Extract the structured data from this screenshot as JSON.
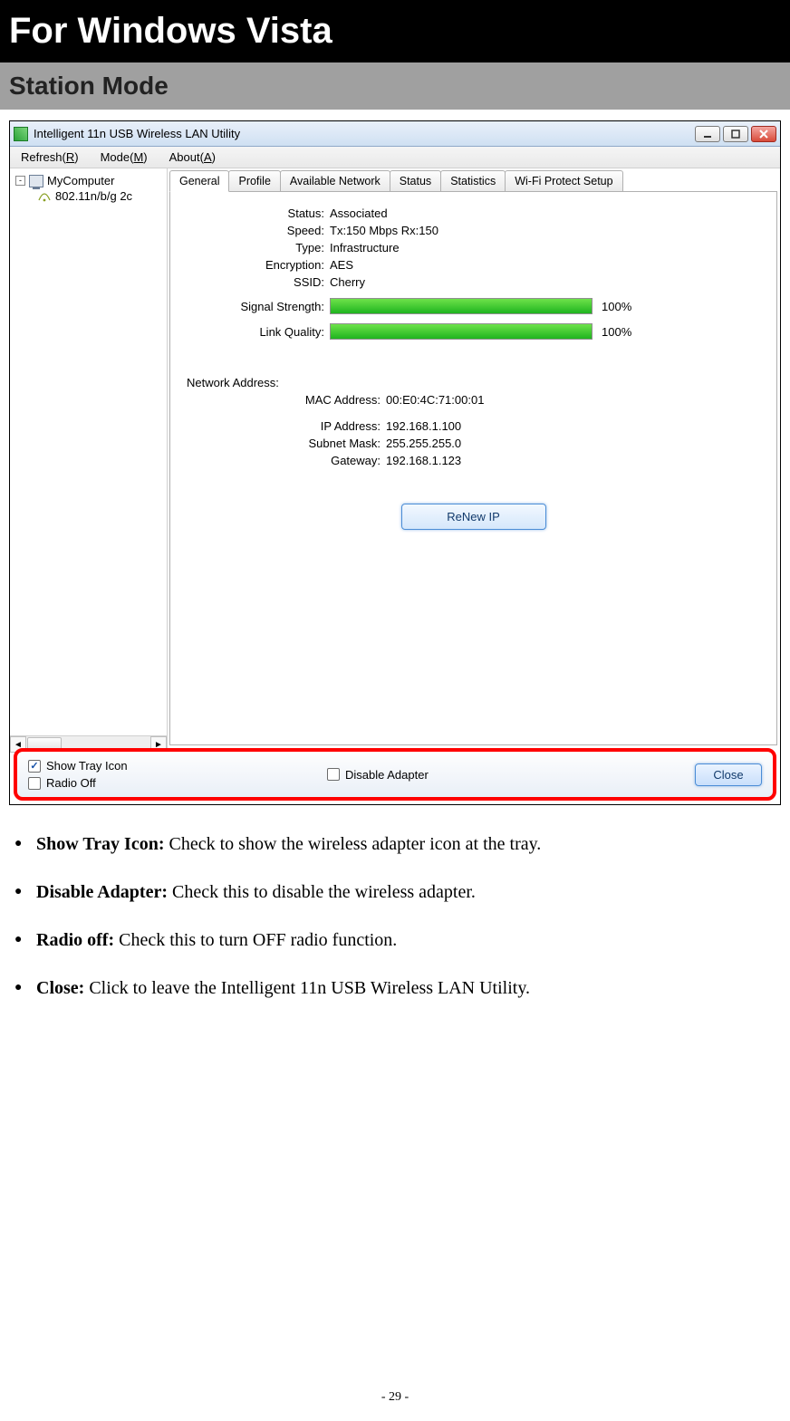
{
  "page": {
    "heading1": "For Windows Vista",
    "heading2": "Station Mode",
    "number": "- 29 -"
  },
  "window": {
    "title": "Intelligent 11n USB Wireless LAN Utility",
    "menu": {
      "refresh": "Refresh(R)",
      "mode": "Mode(M)",
      "about": "About(A)"
    },
    "tree": {
      "root": "MyComputer",
      "child": "802.11n/b/g 2c"
    },
    "tabs": [
      "General",
      "Profile",
      "Available Network",
      "Status",
      "Statistics",
      "Wi-Fi Protect Setup"
    ],
    "general": {
      "labels": {
        "status": "Status:",
        "speed": "Speed:",
        "type": "Type:",
        "encryption": "Encryption:",
        "ssid": "SSID:",
        "signal": "Signal Strength:",
        "quality": "Link Quality:",
        "netaddr": "Network Address:",
        "mac": "MAC Address:",
        "ip": "IP Address:",
        "subnet": "Subnet Mask:",
        "gateway": "Gateway:"
      },
      "values": {
        "status": "Associated",
        "speed": "Tx:150 Mbps Rx:150",
        "type": "Infrastructure",
        "encryption": "AES",
        "ssid": "Cherry",
        "signal_pct": "100%",
        "quality_pct": "100%",
        "mac": "00:E0:4C:71:00:01",
        "ip": "192.168.1.100",
        "subnet": "255.255.255.0",
        "gateway": "192.168.1.123"
      },
      "renew_label": "ReNew IP"
    },
    "footer": {
      "show_tray": "Show Tray Icon",
      "radio_off": "Radio Off",
      "disable_adapter": "Disable Adapter",
      "close": "Close"
    }
  },
  "bullets": [
    {
      "term": "Show Tray Icon:",
      "desc": " Check to show the wireless adapter icon at the tray."
    },
    {
      "term": "Disable Adapter:",
      "desc": " Check this to disable the wireless adapter."
    },
    {
      "term": "Radio off:",
      "desc": " Check this to turn OFF radio function."
    },
    {
      "term": "Close:",
      "desc": " Click to leave the Intelligent 11n USB Wireless LAN Utility."
    }
  ]
}
